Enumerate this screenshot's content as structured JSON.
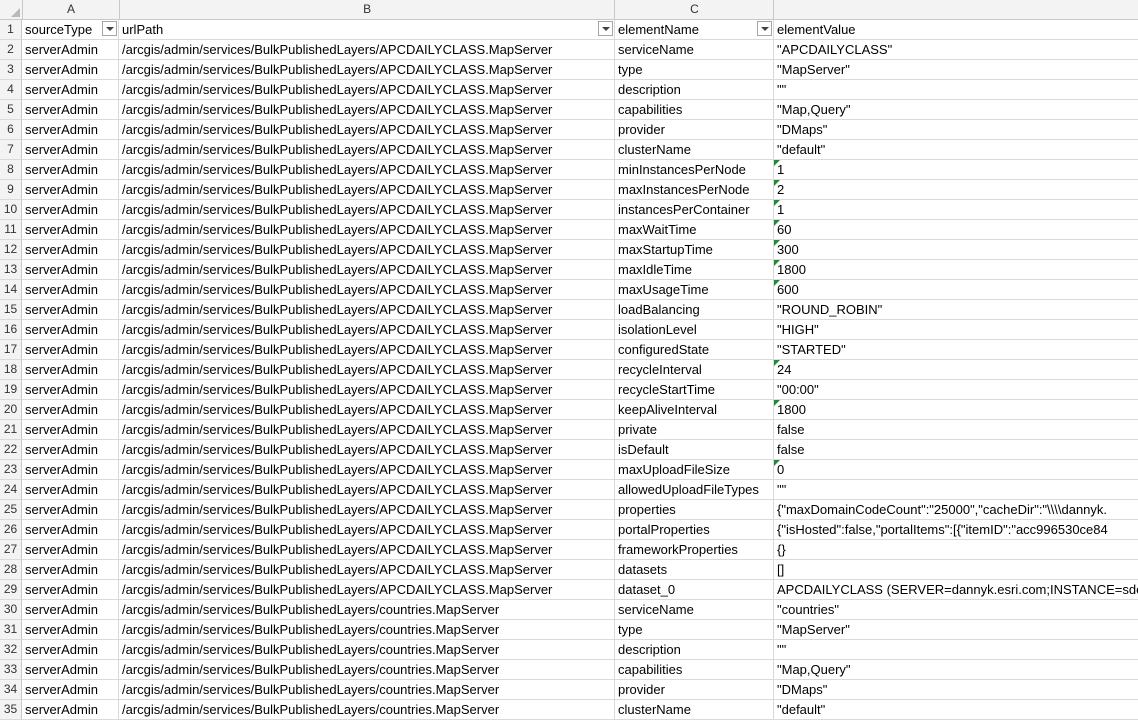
{
  "columns": [
    "A",
    "B",
    "C",
    ""
  ],
  "headers": [
    "sourceType",
    "urlPath",
    "elementName",
    "elementValue"
  ],
  "header_row_number": "1",
  "rows": [
    {
      "n": "2",
      "a": "serverAdmin",
      "b": "/arcgis/admin/services/BulkPublishedLayers/APCDAILYCLASS.MapServer",
      "c": "serviceName",
      "d": "\"APCDAILYCLASS\"",
      "num": false
    },
    {
      "n": "3",
      "a": "serverAdmin",
      "b": "/arcgis/admin/services/BulkPublishedLayers/APCDAILYCLASS.MapServer",
      "c": "type",
      "d": "\"MapServer\"",
      "num": false
    },
    {
      "n": "4",
      "a": "serverAdmin",
      "b": "/arcgis/admin/services/BulkPublishedLayers/APCDAILYCLASS.MapServer",
      "c": "description",
      "d": "\"\"",
      "num": false
    },
    {
      "n": "5",
      "a": "serverAdmin",
      "b": "/arcgis/admin/services/BulkPublishedLayers/APCDAILYCLASS.MapServer",
      "c": "capabilities",
      "d": "\"Map,Query\"",
      "num": false
    },
    {
      "n": "6",
      "a": "serverAdmin",
      "b": "/arcgis/admin/services/BulkPublishedLayers/APCDAILYCLASS.MapServer",
      "c": "provider",
      "d": "\"DMaps\"",
      "num": false
    },
    {
      "n": "7",
      "a": "serverAdmin",
      "b": "/arcgis/admin/services/BulkPublishedLayers/APCDAILYCLASS.MapServer",
      "c": "clusterName",
      "d": "\"default\"",
      "num": false
    },
    {
      "n": "8",
      "a": "serverAdmin",
      "b": "/arcgis/admin/services/BulkPublishedLayers/APCDAILYCLASS.MapServer",
      "c": "minInstancesPerNode",
      "d": "1",
      "num": true
    },
    {
      "n": "9",
      "a": "serverAdmin",
      "b": "/arcgis/admin/services/BulkPublishedLayers/APCDAILYCLASS.MapServer",
      "c": "maxInstancesPerNode",
      "d": "2",
      "num": true
    },
    {
      "n": "10",
      "a": "serverAdmin",
      "b": "/arcgis/admin/services/BulkPublishedLayers/APCDAILYCLASS.MapServer",
      "c": "instancesPerContainer",
      "d": "1",
      "num": true
    },
    {
      "n": "11",
      "a": "serverAdmin",
      "b": "/arcgis/admin/services/BulkPublishedLayers/APCDAILYCLASS.MapServer",
      "c": "maxWaitTime",
      "d": "60",
      "num": true
    },
    {
      "n": "12",
      "a": "serverAdmin",
      "b": "/arcgis/admin/services/BulkPublishedLayers/APCDAILYCLASS.MapServer",
      "c": "maxStartupTime",
      "d": "300",
      "num": true
    },
    {
      "n": "13",
      "a": "serverAdmin",
      "b": "/arcgis/admin/services/BulkPublishedLayers/APCDAILYCLASS.MapServer",
      "c": "maxIdleTime",
      "d": "1800",
      "num": true
    },
    {
      "n": "14",
      "a": "serverAdmin",
      "b": "/arcgis/admin/services/BulkPublishedLayers/APCDAILYCLASS.MapServer",
      "c": "maxUsageTime",
      "d": "600",
      "num": true
    },
    {
      "n": "15",
      "a": "serverAdmin",
      "b": "/arcgis/admin/services/BulkPublishedLayers/APCDAILYCLASS.MapServer",
      "c": "loadBalancing",
      "d": "\"ROUND_ROBIN\"",
      "num": false
    },
    {
      "n": "16",
      "a": "serverAdmin",
      "b": "/arcgis/admin/services/BulkPublishedLayers/APCDAILYCLASS.MapServer",
      "c": "isolationLevel",
      "d": "\"HIGH\"",
      "num": false
    },
    {
      "n": "17",
      "a": "serverAdmin",
      "b": "/arcgis/admin/services/BulkPublishedLayers/APCDAILYCLASS.MapServer",
      "c": "configuredState",
      "d": "\"STARTED\"",
      "num": false
    },
    {
      "n": "18",
      "a": "serverAdmin",
      "b": "/arcgis/admin/services/BulkPublishedLayers/APCDAILYCLASS.MapServer",
      "c": "recycleInterval",
      "d": "24",
      "num": true
    },
    {
      "n": "19",
      "a": "serverAdmin",
      "b": "/arcgis/admin/services/BulkPublishedLayers/APCDAILYCLASS.MapServer",
      "c": "recycleStartTime",
      "d": "\"00:00\"",
      "num": false
    },
    {
      "n": "20",
      "a": "serverAdmin",
      "b": "/arcgis/admin/services/BulkPublishedLayers/APCDAILYCLASS.MapServer",
      "c": "keepAliveInterval",
      "d": "1800",
      "num": true
    },
    {
      "n": "21",
      "a": "serverAdmin",
      "b": "/arcgis/admin/services/BulkPublishedLayers/APCDAILYCLASS.MapServer",
      "c": "private",
      "d": "false",
      "num": false
    },
    {
      "n": "22",
      "a": "serverAdmin",
      "b": "/arcgis/admin/services/BulkPublishedLayers/APCDAILYCLASS.MapServer",
      "c": "isDefault",
      "d": "false",
      "num": false
    },
    {
      "n": "23",
      "a": "serverAdmin",
      "b": "/arcgis/admin/services/BulkPublishedLayers/APCDAILYCLASS.MapServer",
      "c": "maxUploadFileSize",
      "d": "0",
      "num": true
    },
    {
      "n": "24",
      "a": "serverAdmin",
      "b": "/arcgis/admin/services/BulkPublishedLayers/APCDAILYCLASS.MapServer",
      "c": "allowedUploadFileTypes",
      "d": "\"\"",
      "num": false
    },
    {
      "n": "25",
      "a": "serverAdmin",
      "b": "/arcgis/admin/services/BulkPublishedLayers/APCDAILYCLASS.MapServer",
      "c": "properties",
      "d": "{\"maxDomainCodeCount\":\"25000\",\"cacheDir\":\"\\\\\\\\dannyk.",
      "num": false
    },
    {
      "n": "26",
      "a": "serverAdmin",
      "b": "/arcgis/admin/services/BulkPublishedLayers/APCDAILYCLASS.MapServer",
      "c": "portalProperties",
      "d": "{\"isHosted\":false,\"portalItems\":[{\"itemID\":\"acc996530ce84",
      "num": false
    },
    {
      "n": "27",
      "a": "serverAdmin",
      "b": "/arcgis/admin/services/BulkPublishedLayers/APCDAILYCLASS.MapServer",
      "c": "frameworkProperties",
      "d": "{}",
      "num": false
    },
    {
      "n": "28",
      "a": "serverAdmin",
      "b": "/arcgis/admin/services/BulkPublishedLayers/APCDAILYCLASS.MapServer",
      "c": "datasets",
      "d": "[]",
      "num": false
    },
    {
      "n": "29",
      "a": "serverAdmin",
      "b": "/arcgis/admin/services/BulkPublishedLayers/APCDAILYCLASS.MapServer",
      "c": "dataset_0",
      "d": "APCDAILYCLASS (SERVER=dannyk.esri.com;INSTANCE=sde:s",
      "num": false
    },
    {
      "n": "30",
      "a": "serverAdmin",
      "b": "/arcgis/admin/services/BulkPublishedLayers/countries.MapServer",
      "c": "serviceName",
      "d": "\"countries\"",
      "num": false
    },
    {
      "n": "31",
      "a": "serverAdmin",
      "b": "/arcgis/admin/services/BulkPublishedLayers/countries.MapServer",
      "c": "type",
      "d": "\"MapServer\"",
      "num": false
    },
    {
      "n": "32",
      "a": "serverAdmin",
      "b": "/arcgis/admin/services/BulkPublishedLayers/countries.MapServer",
      "c": "description",
      "d": "\"\"",
      "num": false
    },
    {
      "n": "33",
      "a": "serverAdmin",
      "b": "/arcgis/admin/services/BulkPublishedLayers/countries.MapServer",
      "c": "capabilities",
      "d": "\"Map,Query\"",
      "num": false
    },
    {
      "n": "34",
      "a": "serverAdmin",
      "b": "/arcgis/admin/services/BulkPublishedLayers/countries.MapServer",
      "c": "provider",
      "d": "\"DMaps\"",
      "num": false
    },
    {
      "n": "35",
      "a": "serverAdmin",
      "b": "/arcgis/admin/services/BulkPublishedLayers/countries.MapServer",
      "c": "clusterName",
      "d": "\"default\"",
      "num": false
    }
  ]
}
